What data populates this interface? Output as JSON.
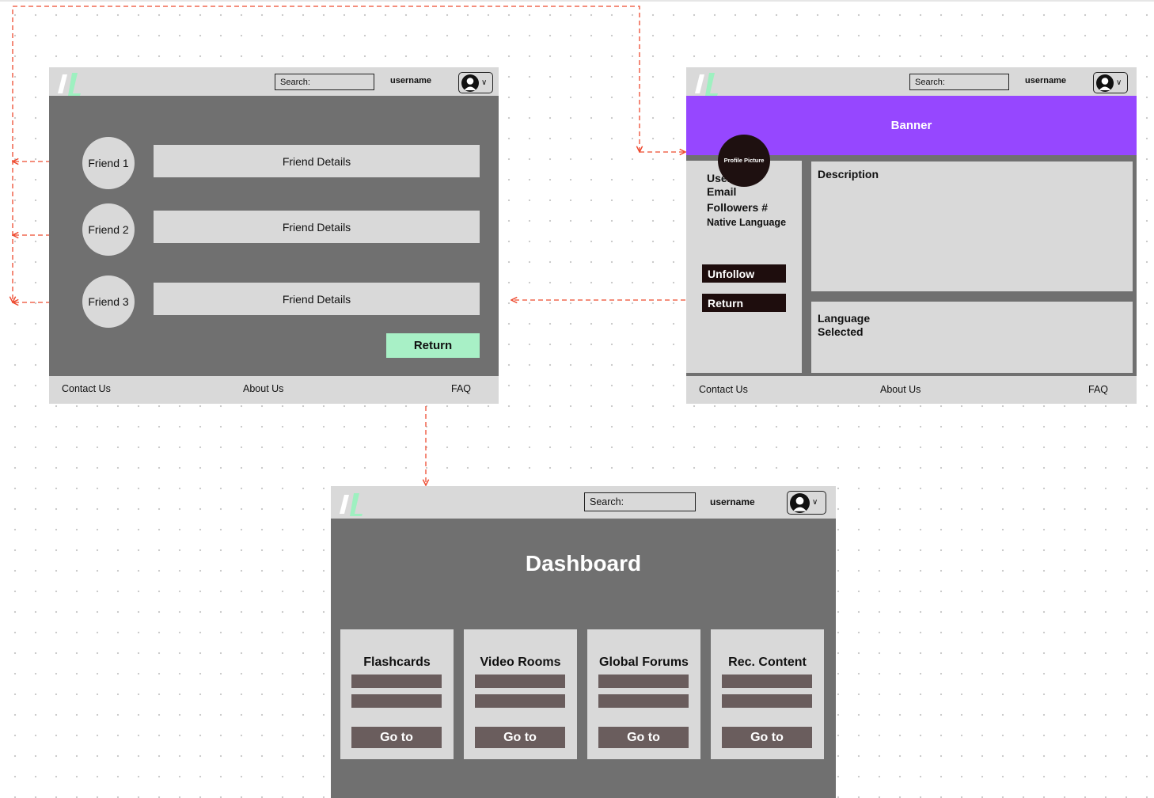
{
  "header": {
    "search_label": "Search:",
    "username": "username"
  },
  "footer": {
    "contact": "Contact Us",
    "about": "About Us",
    "faq": "FAQ"
  },
  "friends_page": {
    "friends": [
      {
        "name": "Friend 1",
        "details": "Friend Details"
      },
      {
        "name": "Friend 2",
        "details": "Friend Details"
      },
      {
        "name": "Friend 3",
        "details": "Friend Details"
      }
    ],
    "return_label": "Return"
  },
  "profile_page": {
    "banner": "Banner",
    "profile_picture": "Profile Picture",
    "username": "Username",
    "email": "Email",
    "followers": "Followers #",
    "native_language": "Native Language",
    "unfollow_label": "Unfollow",
    "return_label": "Return",
    "description_title": "Description",
    "language_title_line1": "Language",
    "language_title_line2": "Selected"
  },
  "dashboard_page": {
    "title": "Dashboard",
    "cards": [
      {
        "title": "Flashcards",
        "button": "Go to"
      },
      {
        "title": "Video Rooms",
        "button": "Go to"
      },
      {
        "title": "Global Forums",
        "button": "Go to"
      },
      {
        "title": "Rec. Content",
        "button": "Go to"
      }
    ]
  },
  "colors": {
    "frame_bg": "#707070",
    "panel_bg": "#d9d9d9",
    "banner": "#9647ff",
    "return_green": "#a8f0c6",
    "dark_button": "#1e0d0d",
    "card_bar": "#6a5d5d",
    "connector": "#ee4a2f",
    "logo_white": "#ffffff",
    "logo_green": "#9ef0c0"
  },
  "icons": {
    "logo": "app-logo",
    "avatar": "user-avatar-icon",
    "chevron": "chevron-down-icon"
  }
}
